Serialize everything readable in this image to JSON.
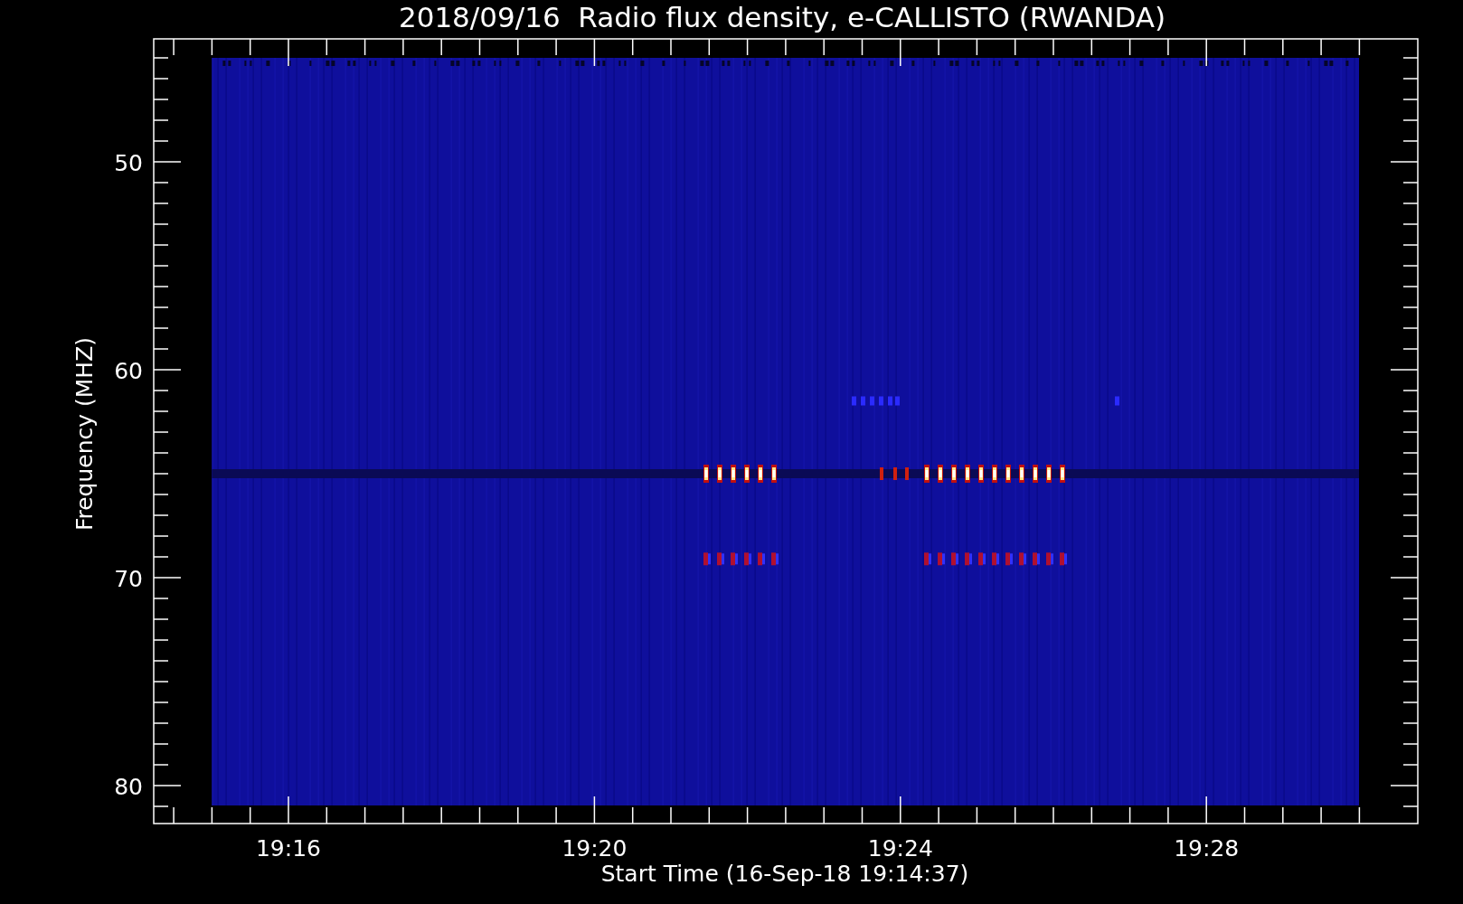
{
  "title": "2018/09/16  Radio flux density, e-CALLISTO (RWANDA)",
  "y_axis": {
    "label": "Frequency (MHZ)",
    "tick_labels": [
      "50",
      "60",
      "70",
      "80"
    ]
  },
  "x_axis": {
    "label": "Start Time (16-Sep-18 19:14:37)",
    "tick_labels": [
      "19:16",
      "19:20",
      "19:24",
      "19:28"
    ]
  }
}
